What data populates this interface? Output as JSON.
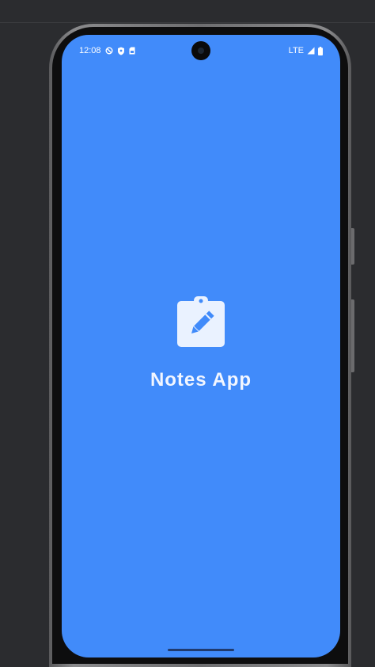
{
  "status_bar": {
    "time": "12:08",
    "network": "LTE",
    "icons": [
      "do-not-disturb-icon",
      "shield-icon",
      "sim-card-icon",
      "signal-icon",
      "battery-icon"
    ]
  },
  "splash": {
    "title": "Notes App",
    "icon": "clipboard-edit-icon"
  },
  "colors": {
    "screen_background": "#418bfa",
    "icon_fill": "#eaf2ff",
    "title_text": "#f2f6ff"
  }
}
